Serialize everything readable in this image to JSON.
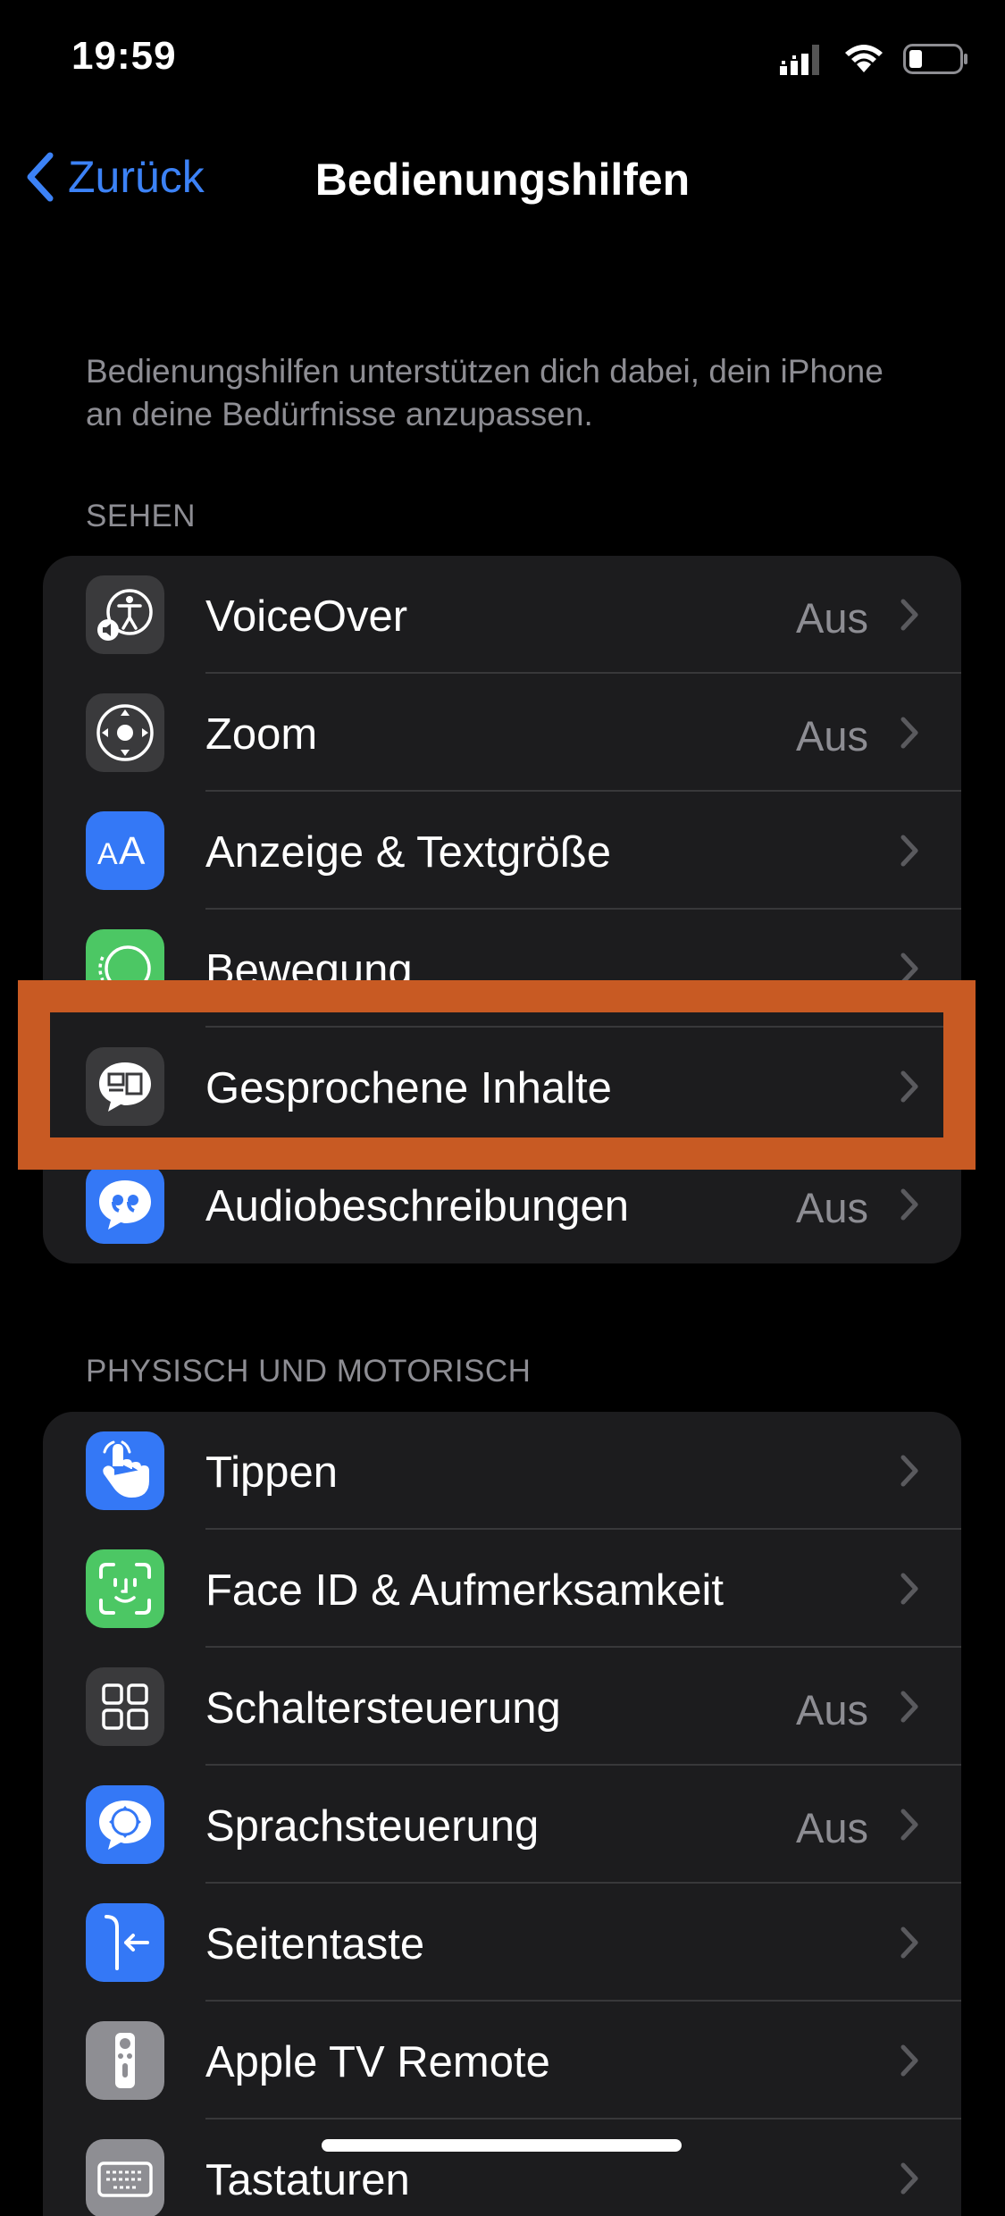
{
  "status": {
    "time": "19:59"
  },
  "nav": {
    "back_label": "Zurück",
    "title": "Bedienungshilfen"
  },
  "intro": "Bedienungshilfen unterstützen dich dabei, dein iPhone an deine Bedürfnisse anzupassen.",
  "sections": [
    {
      "header": "SEHEN",
      "items": [
        {
          "label": "VoiceOver",
          "value": "Aus",
          "icon": "voiceover-icon",
          "icon_bg": "#3a3a3c"
        },
        {
          "label": "Zoom",
          "value": "Aus",
          "icon": "zoom-icon",
          "icon_bg": "#3a3a3c"
        },
        {
          "label": "Anzeige & Textgröße",
          "value": "",
          "icon": "text-size-icon",
          "icon_bg": "#3478f6"
        },
        {
          "label": "Bewegung",
          "value": "",
          "icon": "motion-icon",
          "icon_bg": "#4cc764"
        },
        {
          "label": "Gesprochene Inhalte",
          "value": "",
          "icon": "spoken-content-icon",
          "icon_bg": "#3a3a3c"
        },
        {
          "label": "Audiobeschreibungen",
          "value": "Aus",
          "icon": "audio-description-icon",
          "icon_bg": "#3478f6"
        }
      ]
    },
    {
      "header": "PHYSISCH UND MOTORISCH",
      "items": [
        {
          "label": "Tippen",
          "value": "",
          "icon": "touch-icon",
          "icon_bg": "#3478f6"
        },
        {
          "label": "Face ID & Aufmerksamkeit",
          "value": "",
          "icon": "face-id-icon",
          "icon_bg": "#4cc764"
        },
        {
          "label": "Schaltersteuerung",
          "value": "Aus",
          "icon": "switch-control-icon",
          "icon_bg": "#3a3a3c"
        },
        {
          "label": "Sprachsteuerung",
          "value": "Aus",
          "icon": "voice-control-icon",
          "icon_bg": "#3478f6"
        },
        {
          "label": "Seitentaste",
          "value": "",
          "icon": "side-button-icon",
          "icon_bg": "#3478f6"
        },
        {
          "label": "Apple TV Remote",
          "value": "",
          "icon": "tv-remote-icon",
          "icon_bg": "#8e8e93"
        },
        {
          "label": "Tastaturen",
          "value": "",
          "icon": "keyboard-icon",
          "icon_bg": "#8e8e93"
        }
      ]
    }
  ],
  "colors": {
    "accent": "#3c82f6",
    "highlight": "#c85a23",
    "secondary_text": "#8d8d93"
  }
}
